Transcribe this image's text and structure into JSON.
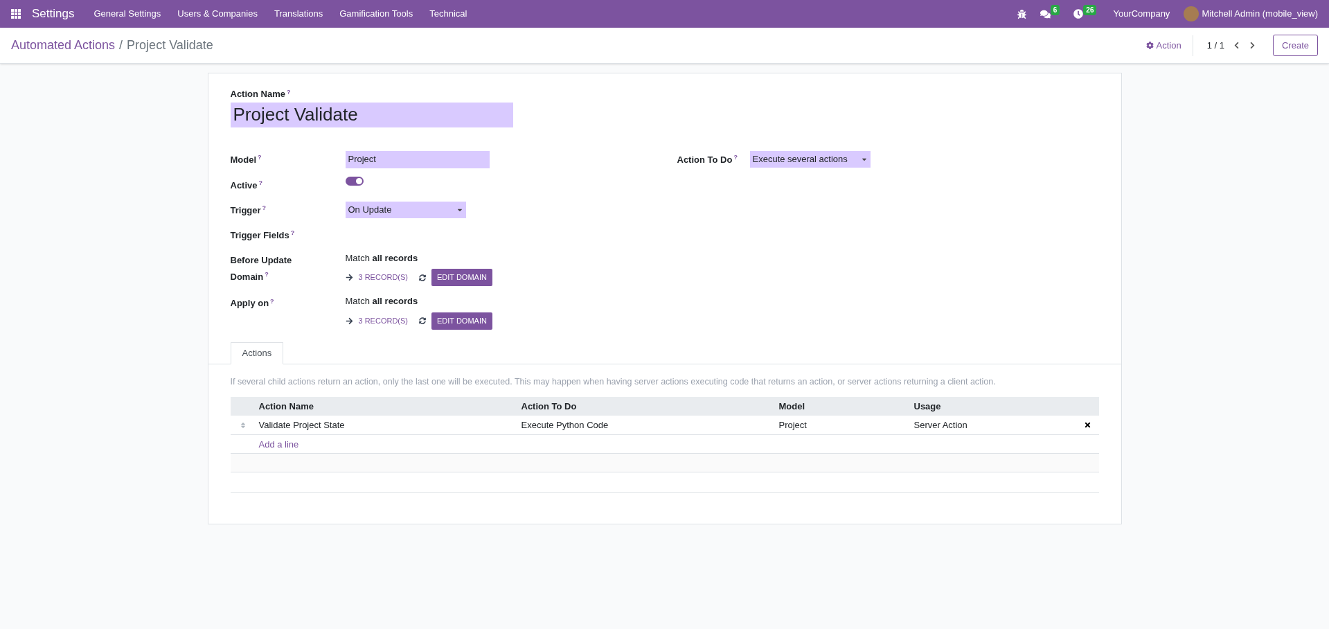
{
  "navbar": {
    "app": "Settings",
    "menus": [
      "General Settings",
      "Users & Companies",
      "Translations",
      "Gamification Tools",
      "Technical"
    ],
    "messages_count": "6",
    "activities_count": "26",
    "company": "YourCompany",
    "user": "Mitchell Admin (mobile_view)"
  },
  "control_panel": {
    "breadcrumb": [
      "Automated Actions",
      "Project Validate"
    ],
    "breadcrumb_separator": "/",
    "action_button": "Action",
    "pager": "1 / 1",
    "create_button": "Create"
  },
  "form": {
    "name_label": "Action Name",
    "name_help": "?",
    "name_value": "Project Validate",
    "left_fields": [
      {
        "kind": "input",
        "label": "Model",
        "help": "?",
        "value": "Project"
      },
      {
        "kind": "toggle",
        "label": "Active",
        "help": "?",
        "on": true
      },
      {
        "kind": "select",
        "label": "Trigger",
        "help": "?",
        "value": "On Update"
      },
      {
        "kind": "empty",
        "label": "Trigger Fields",
        "help": "?"
      },
      {
        "kind": "domain",
        "label": "Before Update Domain",
        "help": "?",
        "match": "Match **all records**",
        "records": "3 RECORD(S)",
        "button": "EDIT DOMAIN"
      },
      {
        "kind": "domain",
        "label": "Apply on",
        "help": "?",
        "match": "Match **all records**",
        "records": "3 RECORD(S)",
        "button": "EDIT DOMAIN"
      }
    ],
    "right_fields": [
      {
        "kind": "select",
        "label": "Action To Do",
        "help": "?",
        "value": "Execute several actions"
      }
    ],
    "tabs": [
      {
        "label": "Actions",
        "selected": true
      }
    ],
    "hint": "If several child actions return an action, only the last one will be executed. This may happen when having server actions executing code that returns an action, or server actions returning a client action.",
    "table": {
      "columns": [
        "Action Name",
        "Action To Do",
        "Model",
        "Usage"
      ],
      "rows": [
        {
          "cells": [
            "Validate Project State",
            "Execute Python Code",
            "Project",
            "Server Action"
          ]
        }
      ],
      "add_line": "Add a line"
    }
  }
}
